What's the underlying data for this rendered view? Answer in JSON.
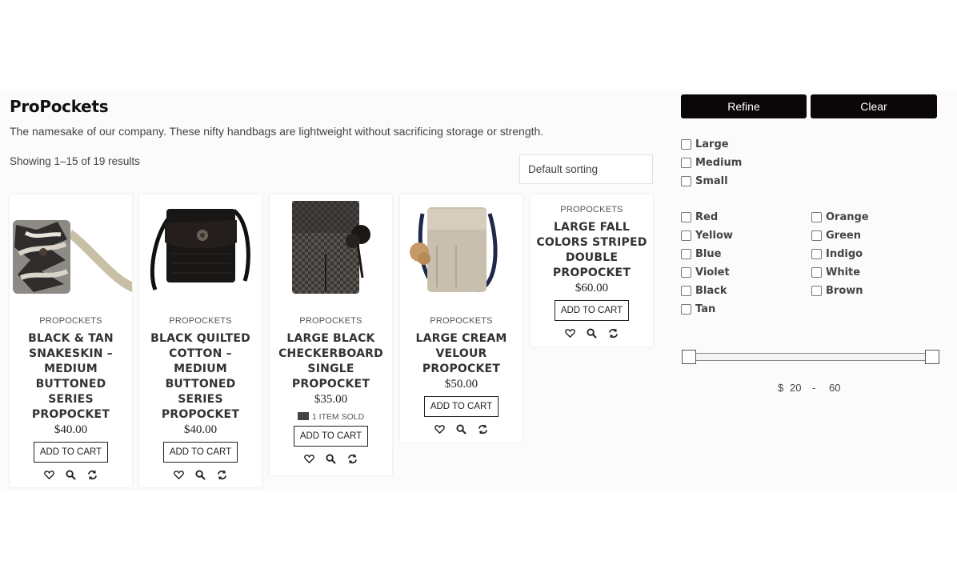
{
  "category": {
    "title": "ProPockets",
    "description": "The namesake of our company. These nifty handbags are lightweight without sacrificing storage or strength."
  },
  "results": {
    "count_text": "Showing 1–15 of 19 results"
  },
  "sorting": {
    "selected": "Default sorting"
  },
  "products": [
    {
      "category": "PROPOCKETS",
      "title": "BLACK & TAN SNAKESKIN – MEDIUM BUTTONED SERIES PROPOCKET",
      "price": "$40.00",
      "cart_label": "ADD TO CART"
    },
    {
      "category": "PROPOCKETS",
      "title": "BLACK QUILTED COTTON – MEDIUM BUTTONED SERIES PROPOCKET",
      "price": "$40.00",
      "cart_label": "ADD TO CART"
    },
    {
      "category": "PROPOCKETS",
      "title": "LARGE BLACK CHECKERBOARD SINGLE PROPOCKET",
      "price": "$35.00",
      "sold": "1 ITEM SOLD",
      "cart_label": "ADD TO CART"
    },
    {
      "category": "PROPOCKETS",
      "title": "LARGE CREAM VELOUR PROPOCKET",
      "price": "$50.00",
      "cart_label": "ADD TO CART"
    },
    {
      "category": "PROPOCKETS",
      "title": "LARGE FALL COLORS STRIPED DOUBLE PROPOCKET",
      "price": "$60.00",
      "cart_label": "ADD TO CART"
    }
  ],
  "filters": {
    "refine_label": "Refine",
    "clear_label": "Clear",
    "sizes": [
      "Large",
      "Medium",
      "Small"
    ],
    "colors_left": [
      "Red",
      "Yellow",
      "Blue",
      "Violet",
      "Black",
      "Tan"
    ],
    "colors_right": [
      "Orange",
      "Green",
      "Indigo",
      "White",
      "Brown"
    ],
    "price": {
      "currency": "$",
      "min": "20",
      "separator": "-",
      "max": "60"
    }
  },
  "icons": {
    "wishlist": "heart-icon",
    "quickview": "search-icon",
    "compare": "refresh-icon",
    "sold": "envelope-icon"
  },
  "colors": {
    "button_bg": "#0b0708",
    "band_bg": "#fbfbfb"
  }
}
